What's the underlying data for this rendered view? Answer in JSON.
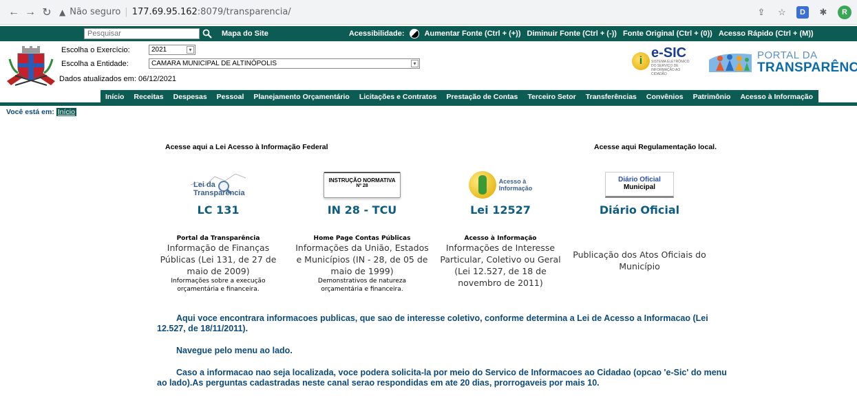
{
  "browser": {
    "insecure_label": "Não seguro",
    "url_host": "177.69.95.162",
    "url_path": ":8079/transparencia/",
    "extension_letter": "D",
    "profile_letter": "R"
  },
  "topbar": {
    "search_placeholder": "Pesquisar",
    "site_map": "Mapa do Site",
    "accessibility_label": "Acessibilidade:",
    "increase_font": "Aumentar Fonte (Ctrl + (+))",
    "decrease_font": "Diminuir Fonte (Ctrl + (-))",
    "original_font": "Fonte Original (Ctrl + (0))",
    "quick_access": "Acesso Rápido (Ctrl + (M))"
  },
  "header": {
    "exercise_label": "Escolha o Exercício:",
    "exercise_value": "2021",
    "entity_label": "Escolha a Entidade:",
    "entity_value": "CAMARA MUNICIPAL DE ALTINÓPOLIS",
    "updated": "Dados atualizados em: 06/12/2021",
    "esic_title": "e-SIC",
    "esic_sub": "SISTEMA ELETRÔNICO DO SERVIÇO DE INFORMAÇÃO AO CIDADÃO",
    "portal_line1": "PORTAL DA",
    "portal_line2": "TRANSPARÊNCIA"
  },
  "menu": [
    "Início",
    "Receitas",
    "Despesas",
    "Pessoal",
    "Planejamento Orçamentário",
    "Licitações e Contratos",
    "Prestação de Contas",
    "Terceiro Setor",
    "Transferências",
    "Convênios",
    "Patrimônio",
    "Acesso à Informação"
  ],
  "breadcrumb": {
    "label": "Você está em:",
    "current": "Início"
  },
  "content": {
    "federal_heading": "Acesse aqui a Lei Acesso à Informação Federal",
    "local_heading": "Acesse aqui Regulamentação local.",
    "cards": [
      {
        "logo_line1": "Lei da",
        "logo_line2": "Transparência",
        "title": "LC 131",
        "sub": "Portal da Transparência",
        "desc": "Informação de Finanças Públicas (Lei 131, de 27 de maio de 2009)",
        "note": "Informações sobre a execução orçamentária e financeira."
      },
      {
        "logo_line1": "INSTRUÇÃO NORMATIVA",
        "logo_line2": "Nº 28",
        "title": "IN 28 - TCU",
        "sub": "Home Page Contas Públicas",
        "desc": "Informações da União, Estados e Municípios (IN - 28, de 05 de maio de 1999)",
        "note": "Demonstrativos de natureza orçamentária e financeira."
      },
      {
        "logo_line1": "Acesso à",
        "logo_line2": "Informação",
        "title": "Lei 12527",
        "sub": "Acesso à Informação",
        "desc": "Informações de Interesse Particular, Coletivo ou Geral (Lei 12.527, de 18 de novembro de 2011)",
        "note": ""
      },
      {
        "logo_line1": "Diário Oficial",
        "logo_line2": "Municipal",
        "title": "Diário Oficial",
        "sub": "",
        "desc": "Publicação dos Atos Oficiais do Município",
        "note": ""
      }
    ],
    "intro": [
      "Aqui voce encontrara informacoes publicas, que sao de interesse coletivo, conforme determina a Lei de Acesso a Informacao (Lei 12.527, de 18/11/2011).",
      "Navegue pelo menu ao lado.",
      "Caso a informacao nao seja localizada, voce podera solicita-la por meio do Servico de Informacoes ao Cidadao (opcao 'e-Sic' do menu ao lado).As perguntas cadastradas neste canal serao respondidas em ate 20 dias, prorrogaveis por mais 10."
    ]
  },
  "colors": {
    "primary_green": "#0d5c54",
    "link_blue": "#0d5c84",
    "text_blue": "#0d4a7a"
  }
}
